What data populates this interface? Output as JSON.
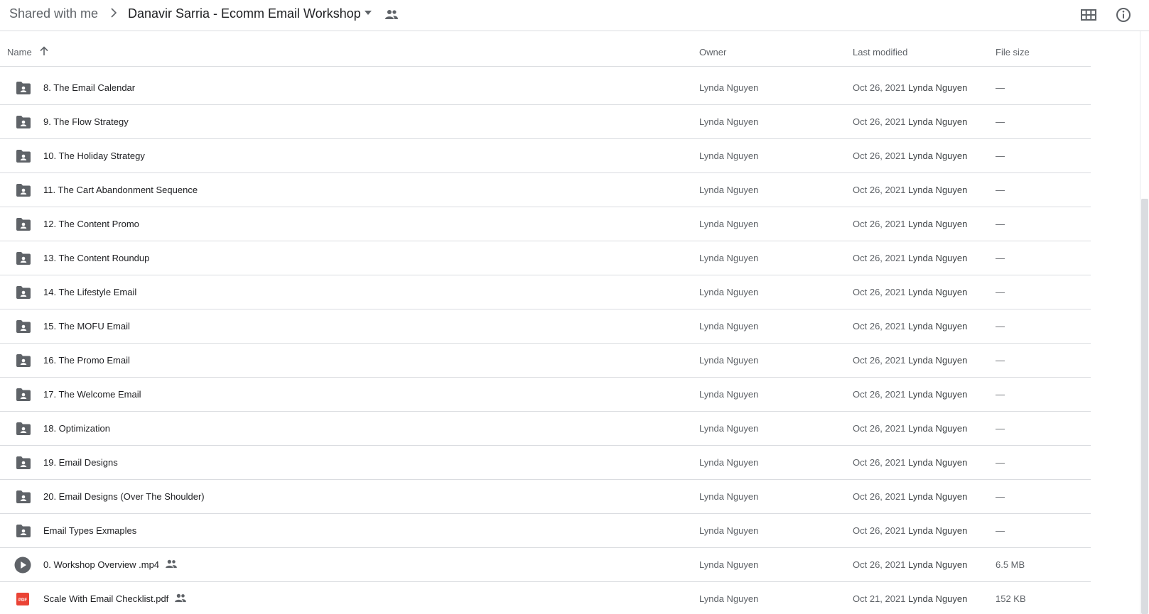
{
  "breadcrumb": {
    "root": "Shared with me",
    "current": "Danavir Sarria - Ecomm Email Workshop"
  },
  "columns": {
    "name": "Name",
    "owner": "Owner",
    "last_modified": "Last modified",
    "file_size": "File size"
  },
  "rows": [
    {
      "name": "8. The Email Calendar",
      "type": "folder",
      "owner": "Lynda Nguyen",
      "date": "Oct 26, 2021",
      "by": "Lynda Nguyen",
      "size": "—",
      "shared": false
    },
    {
      "name": "9. The Flow Strategy",
      "type": "folder",
      "owner": "Lynda Nguyen",
      "date": "Oct 26, 2021",
      "by": "Lynda Nguyen",
      "size": "—",
      "shared": false
    },
    {
      "name": "10. The Holiday Strategy",
      "type": "folder",
      "owner": "Lynda Nguyen",
      "date": "Oct 26, 2021",
      "by": "Lynda Nguyen",
      "size": "—",
      "shared": false
    },
    {
      "name": "11. The Cart Abandonment Sequence",
      "type": "folder",
      "owner": "Lynda Nguyen",
      "date": "Oct 26, 2021",
      "by": "Lynda Nguyen",
      "size": "—",
      "shared": false
    },
    {
      "name": "12. The Content Promo",
      "type": "folder",
      "owner": "Lynda Nguyen",
      "date": "Oct 26, 2021",
      "by": "Lynda Nguyen",
      "size": "—",
      "shared": false
    },
    {
      "name": "13. The Content Roundup",
      "type": "folder",
      "owner": "Lynda Nguyen",
      "date": "Oct 26, 2021",
      "by": "Lynda Nguyen",
      "size": "—",
      "shared": false
    },
    {
      "name": "14. The Lifestyle Email",
      "type": "folder",
      "owner": "Lynda Nguyen",
      "date": "Oct 26, 2021",
      "by": "Lynda Nguyen",
      "size": "—",
      "shared": false
    },
    {
      "name": "15. The MOFU Email",
      "type": "folder",
      "owner": "Lynda Nguyen",
      "date": "Oct 26, 2021",
      "by": "Lynda Nguyen",
      "size": "—",
      "shared": false
    },
    {
      "name": "16. The Promo Email",
      "type": "folder",
      "owner": "Lynda Nguyen",
      "date": "Oct 26, 2021",
      "by": "Lynda Nguyen",
      "size": "—",
      "shared": false
    },
    {
      "name": "17. The Welcome Email",
      "type": "folder",
      "owner": "Lynda Nguyen",
      "date": "Oct 26, 2021",
      "by": "Lynda Nguyen",
      "size": "—",
      "shared": false
    },
    {
      "name": "18. Optimization",
      "type": "folder",
      "owner": "Lynda Nguyen",
      "date": "Oct 26, 2021",
      "by": "Lynda Nguyen",
      "size": "—",
      "shared": false
    },
    {
      "name": "19. Email Designs",
      "type": "folder",
      "owner": "Lynda Nguyen",
      "date": "Oct 26, 2021",
      "by": "Lynda Nguyen",
      "size": "—",
      "shared": false
    },
    {
      "name": "20. Email Designs (Over The Shoulder)",
      "type": "folder",
      "owner": "Lynda Nguyen",
      "date": "Oct 26, 2021",
      "by": "Lynda Nguyen",
      "size": "—",
      "shared": false
    },
    {
      "name": "Email Types Exmaples",
      "type": "folder",
      "owner": "Lynda Nguyen",
      "date": "Oct 26, 2021",
      "by": "Lynda Nguyen",
      "size": "—",
      "shared": false
    },
    {
      "name": "0. Workshop Overview .mp4",
      "type": "video",
      "owner": "Lynda Nguyen",
      "date": "Oct 26, 2021",
      "by": "Lynda Nguyen",
      "size": "6.5 MB",
      "shared": true
    },
    {
      "name": "Scale With Email Checklist.pdf",
      "type": "pdf",
      "owner": "Lynda Nguyen",
      "date": "Oct 21, 2021",
      "by": "Lynda Nguyen",
      "size": "152 KB",
      "shared": true
    }
  ],
  "icons": {
    "folder": "shared-folder-icon",
    "video": "video-play-icon",
    "pdf": "pdf-icon",
    "pdf_label": "PDF"
  },
  "colors": {
    "icon_gray": "#5f6368",
    "pdf_red": "#ea4335",
    "divider": "#dadce0"
  }
}
